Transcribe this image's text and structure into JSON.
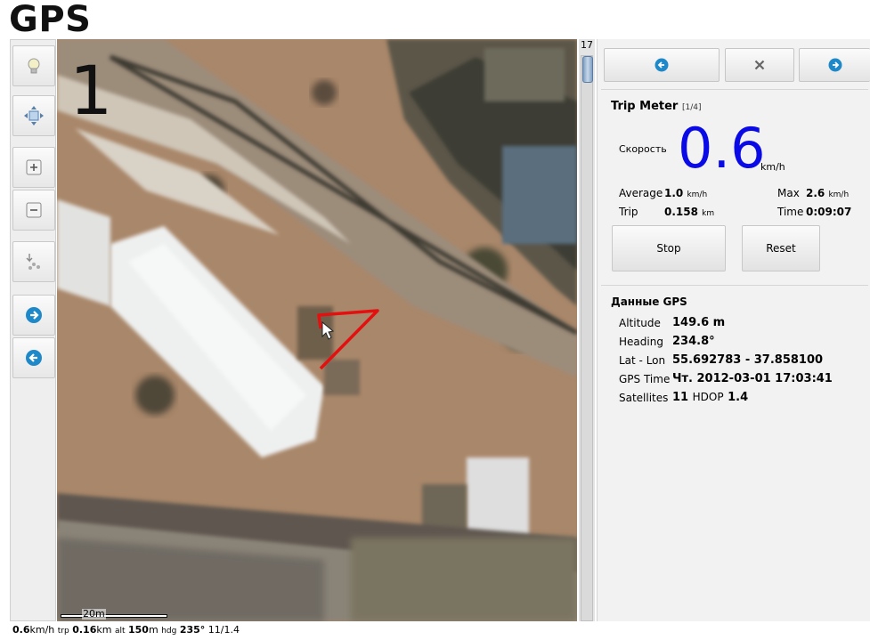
{
  "app": {
    "title": "GPS"
  },
  "toolbar": {
    "buttons": [
      {
        "name": "lightbulb-icon",
        "action": "toggle-light"
      },
      {
        "name": "move-icon",
        "action": "center-map"
      },
      {
        "name": "zoom-in-icon",
        "action": "zoom-in"
      },
      {
        "name": "zoom-out-icon",
        "action": "zoom-out"
      },
      {
        "name": "waypoints-icon",
        "action": "waypoints"
      },
      {
        "name": "arrow-right-icon",
        "action": "next"
      },
      {
        "name": "arrow-left-icon",
        "action": "previous"
      }
    ]
  },
  "map": {
    "zoom_number": "1",
    "scale_label": "20m",
    "track_color": "#e41010"
  },
  "zoom_slider": {
    "level": "17"
  },
  "nav": {
    "prev_icon": "arrow-left-icon",
    "close_icon": "close-icon",
    "next_icon": "arrow-right-icon"
  },
  "trip": {
    "title": "Trip Meter",
    "page": "[1/4]",
    "speed_label": "Скорость",
    "speed_value": "0.6",
    "speed_unit": "km/h",
    "average_label": "Average",
    "average_value": "1.0",
    "average_unit": "km/h",
    "max_label": "Max",
    "max_value": "2.6",
    "max_unit": "km/h",
    "trip_label": "Trip",
    "trip_value": "0.158",
    "trip_unit": "km",
    "time_label": "Time",
    "time_value": "0:09:07",
    "stop_label": "Stop",
    "reset_label": "Reset"
  },
  "gps": {
    "title": "Данные GPS",
    "altitude_label": "Altitude",
    "altitude_value": "149.6 m",
    "heading_label": "Heading",
    "heading_value": "234.8°",
    "latlon_label": "Lat - Lon",
    "latlon_value": "55.692783 - 37.858100",
    "time_label": "GPS Time",
    "time_value": "Чт. 2012-03-01 17:03:41",
    "satellites_label": "Satellites",
    "satellites_value": "11",
    "hdop_label": "HDOP",
    "hdop_value": "1.4"
  },
  "status": {
    "speed": "0.6",
    "speed_unit": "km/h",
    "trip_label": "trp",
    "trip_value": "0.16",
    "trip_unit": "km",
    "alt_label": "alt",
    "alt_value": "150",
    "alt_unit": "m",
    "hdg_label": "hdg",
    "hdg_value": "235°",
    "sats": "11/1.4"
  },
  "colors": {
    "speed": "#0a0ae6",
    "accent": "#1e88c8"
  }
}
